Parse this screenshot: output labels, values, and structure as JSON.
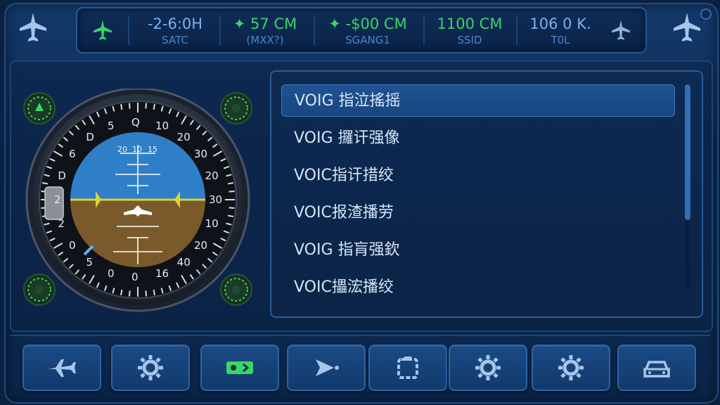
{
  "status_bar": {
    "cells": [
      {
        "value": "-2-6:0H",
        "label": "SATC",
        "color": "#7fb0ea"
      },
      {
        "value": "57 CM",
        "label": "(MXX?)",
        "color": "#3bd46a",
        "marker": "✦"
      },
      {
        "value": "-$00 CM",
        "label": "SGANG1",
        "color": "#3bd46a",
        "marker": "✦"
      },
      {
        "value": "1100 CM",
        "label": "SSID",
        "color": "#3bd46a"
      },
      {
        "value": "106 0 K.",
        "label": "T0L",
        "color": "#7fb0ea"
      }
    ]
  },
  "attitude_indicator": {
    "outer_ticks": [
      "Q",
      "10",
      "20",
      "30",
      "20",
      "30",
      "10",
      "20",
      "40",
      "16",
      "0",
      "0",
      "5",
      "0",
      "2",
      "2",
      "D",
      "6",
      "D",
      "5"
    ],
    "inner_labels": [
      "20",
      "10",
      "15"
    ],
    "colors": {
      "sky": "#2f7fc8",
      "ground": "#7a5a2a",
      "horizon": "#d8d23a"
    }
  },
  "voice_list": {
    "items": [
      {
        "label": "VOIG 指泣搖摇",
        "selected": true
      },
      {
        "label": "VOIG 攞讦强像",
        "selected": false
      },
      {
        "label": "VOIC指讦措绞",
        "selected": false
      },
      {
        "label": "VOIC报渣播劳",
        "selected": false
      },
      {
        "label": "VOIG 指肓强欽",
        "selected": false
      },
      {
        "label": "VOIC攂浤播绞",
        "selected": false
      }
    ],
    "scroll_fraction": 0.66
  },
  "bottom_buttons": [
    {
      "icon": "airplane-icon"
    },
    {
      "icon": "gear-icon"
    },
    {
      "icon": "toggle-icon",
      "accent": "#3bd46a"
    },
    {
      "icon": "arrow-play-icon"
    },
    {
      "icon": "engine-icon"
    },
    {
      "icon": "gear-icon"
    },
    {
      "icon": "gear-icon"
    },
    {
      "icon": "car-icon"
    }
  ],
  "colors": {
    "accent_blue": "#5c9ee4",
    "status_green": "#3bd46a",
    "background": "#0b2142"
  }
}
